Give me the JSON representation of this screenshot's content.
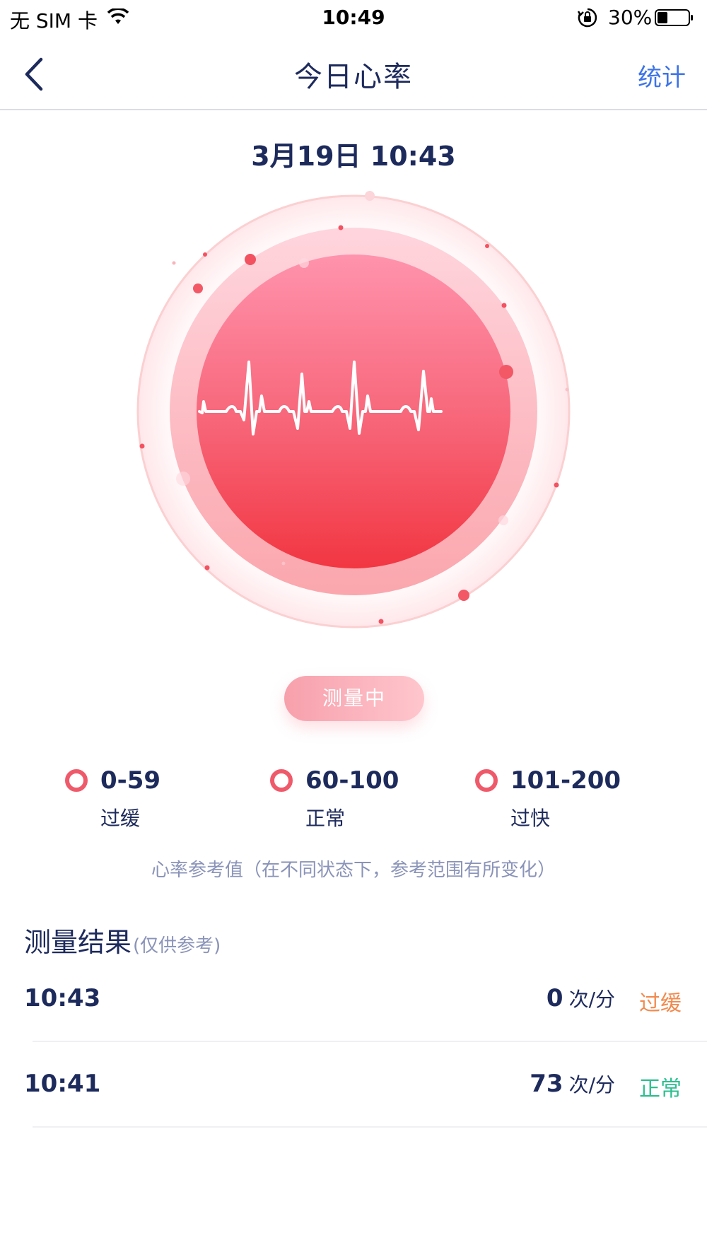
{
  "status_bar": {
    "carrier": "无 SIM 卡",
    "time": "10:49",
    "battery": "30%"
  },
  "nav": {
    "title": "今日心率",
    "action": "统计",
    "back_icon": "chevron-left-icon"
  },
  "measure": {
    "datetime": "3月19日 10:43",
    "button_label": "测量中"
  },
  "ranges": [
    {
      "value": "0-59",
      "label": "过缓"
    },
    {
      "value": "60-100",
      "label": "正常"
    },
    {
      "value": "101-200",
      "label": "过快"
    }
  ],
  "reference_note": "心率参考值（在不同状态下，参考范围有所变化）",
  "results": {
    "title": "测量结果",
    "subtitle": "(仅供参考)",
    "rows": [
      {
        "time": "10:43",
        "bpm": "0",
        "unit": "次/分",
        "status": "过缓",
        "status_color": "#f28a4e"
      },
      {
        "time": "10:41",
        "bpm": "73",
        "unit": "次/分",
        "status": "正常",
        "status_color": "#2dbf8f"
      }
    ]
  },
  "colors": {
    "accent_blue": "#3d74e8",
    "heart_red": "#f03a46",
    "text_dark": "#1d2a5c"
  }
}
